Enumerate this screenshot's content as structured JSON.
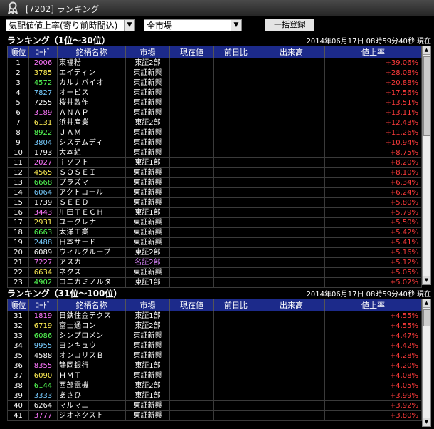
{
  "window": {
    "title": "[7202] ランキング"
  },
  "toolbar": {
    "ranking_type": "気配値値上率(寄り前時間込)",
    "market": "全市場",
    "bulk_button": "一括登録"
  },
  "columns": [
    "順位",
    "ｺｰﾄﾞ",
    "銘柄名称",
    "市場",
    "現在値",
    "前日比",
    "出来高",
    "値上率"
  ],
  "section1": {
    "title": "ランキング（1位～30位）",
    "timestamp": "2014年06月17日  08時59分40秒  現在",
    "rows": [
      {
        "rank": "1",
        "code": "2006",
        "name": "東福粉",
        "market": "東証2部",
        "pct": "+39.06%"
      },
      {
        "rank": "2",
        "code": "3785",
        "name": "エイティン",
        "market": "東証新興",
        "pct": "+28.08%"
      },
      {
        "rank": "3",
        "code": "4572",
        "name": "カルナバイオ",
        "market": "東証新興",
        "pct": "+20.88%"
      },
      {
        "rank": "4",
        "code": "7827",
        "name": "オービス",
        "market": "東証新興",
        "pct": "+17.56%"
      },
      {
        "rank": "5",
        "code": "7255",
        "name": "桜井製作",
        "market": "東証新興",
        "pct": "+13.51%"
      },
      {
        "rank": "6",
        "code": "3189",
        "name": "ＡＮＡＰ",
        "market": "東証新興",
        "pct": "+13.11%"
      },
      {
        "rank": "7",
        "code": "6131",
        "name": "浜井産業",
        "market": "東証2部",
        "pct": "+12.43%"
      },
      {
        "rank": "8",
        "code": "8922",
        "name": "ＪＡＭ",
        "market": "東証新興",
        "pct": "+11.26%"
      },
      {
        "rank": "9",
        "code": "3804",
        "name": "システムディ",
        "market": "東証新興",
        "pct": "+10.94%"
      },
      {
        "rank": "10",
        "code": "1793",
        "name": "大本組",
        "market": "東証新興",
        "pct": "+8.75%"
      },
      {
        "rank": "11",
        "code": "2027",
        "name": "ｉソフト",
        "market": "東証1部",
        "pct": "+8.20%"
      },
      {
        "rank": "12",
        "code": "4565",
        "name": "ＳＯＳＥＩ",
        "market": "東証新興",
        "pct": "+8.10%"
      },
      {
        "rank": "13",
        "code": "6668",
        "name": "プラズマ",
        "market": "東証新興",
        "pct": "+6.34%"
      },
      {
        "rank": "14",
        "code": "6064",
        "name": "アクトコール",
        "market": "東証新興",
        "pct": "+6.24%"
      },
      {
        "rank": "15",
        "code": "1739",
        "name": "ＳＥＥＤ",
        "market": "東証新興",
        "pct": "+5.80%"
      },
      {
        "rank": "16",
        "code": "3443",
        "name": "川田ＴＥＣＨ",
        "market": "東証1部",
        "pct": "+5.79%"
      },
      {
        "rank": "17",
        "code": "2931",
        "name": "ユーグレナ",
        "market": "東証新興",
        "pct": "+5.50%"
      },
      {
        "rank": "18",
        "code": "6663",
        "name": "太洋工業",
        "market": "東証新興",
        "pct": "+5.42%"
      },
      {
        "rank": "19",
        "code": "2488",
        "name": "日本サード",
        "market": "東証新興",
        "pct": "+5.41%"
      },
      {
        "rank": "20",
        "code": "6089",
        "name": "ウィルグループ",
        "market": "東証2部",
        "pct": "+5.16%"
      },
      {
        "rank": "21",
        "code": "7227",
        "name": "アスカ",
        "market": "名証2部",
        "pct": "+5.12%"
      },
      {
        "rank": "22",
        "code": "6634",
        "name": "ネクス",
        "market": "東証新興",
        "pct": "+5.05%"
      },
      {
        "rank": "23",
        "code": "4902",
        "name": "コニカミノルタ",
        "market": "東証1部",
        "pct": "+5.02%"
      }
    ]
  },
  "section2": {
    "title": "ランキング（31位～100位）",
    "timestamp": "2014年06月17日  08時59分40秒  現在",
    "rows": [
      {
        "rank": "31",
        "code": "1819",
        "name": "日鉄住金テクス",
        "market": "東証1部",
        "pct": "+4.55%"
      },
      {
        "rank": "32",
        "code": "6719",
        "name": "富士通コン",
        "market": "東証2部",
        "pct": "+4.55%"
      },
      {
        "rank": "33",
        "code": "6086",
        "name": "シンプロメン",
        "market": "東証新興",
        "pct": "+4.47%"
      },
      {
        "rank": "34",
        "code": "9955",
        "name": "ヨンキュウ",
        "market": "東証新興",
        "pct": "+4.42%"
      },
      {
        "rank": "35",
        "code": "4588",
        "name": "オンコリスＢ",
        "market": "東証新興",
        "pct": "+4.28%"
      },
      {
        "rank": "36",
        "code": "8355",
        "name": "静岡銀行",
        "market": "東証1部",
        "pct": "+4.20%"
      },
      {
        "rank": "37",
        "code": "6090",
        "name": "ＨＭＴ",
        "market": "東証新興",
        "pct": "+4.08%"
      },
      {
        "rank": "38",
        "code": "6144",
        "name": "西部電機",
        "market": "東証2部",
        "pct": "+4.05%"
      },
      {
        "rank": "39",
        "code": "3333",
        "name": "あさひ",
        "market": "東証1部",
        "pct": "+3.99%"
      },
      {
        "rank": "40",
        "code": "6264",
        "name": "マルマエ",
        "market": "東証新興",
        "pct": "+3.92%"
      },
      {
        "rank": "41",
        "code": "3777",
        "name": "ジオネクスト",
        "market": "東証新興",
        "pct": "+3.80%"
      }
    ]
  },
  "code_colors": [
    "#ff77ff",
    "#ffee55",
    "#55ff55",
    "#77ccff",
    "#ffffff"
  ],
  "market_colors": {
    "東証1部": "#ffffff",
    "東証2部": "#ffffff",
    "東証新興": "#ffffff",
    "名証2部": "#dd88ff"
  },
  "colors": {
    "header_bg": "#1c2a8a",
    "positive": "#ff3b3b"
  }
}
